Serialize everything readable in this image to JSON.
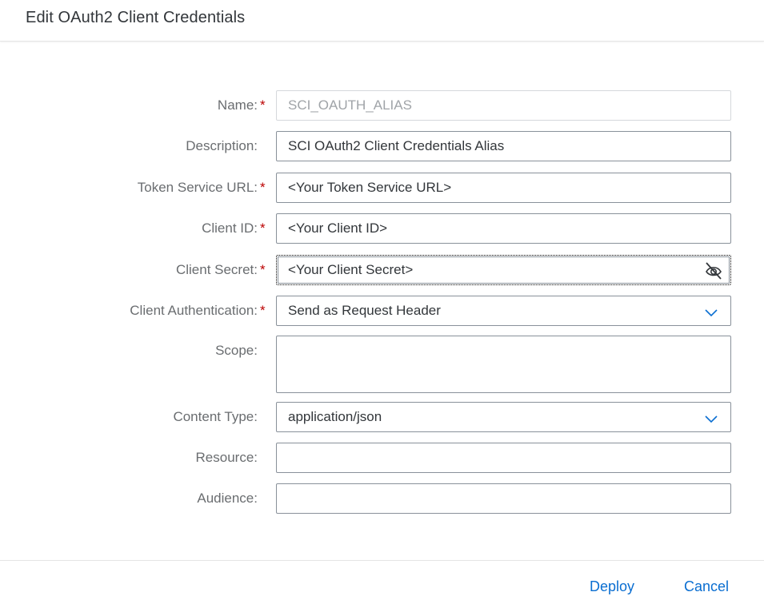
{
  "dialog": {
    "title": "Edit OAuth2 Client Credentials"
  },
  "form": {
    "name": {
      "label": "Name:",
      "required": "*",
      "value": "SCI_OAUTH_ALIAS"
    },
    "description": {
      "label": "Description:",
      "value": "SCI OAuth2 Client Credentials Alias"
    },
    "token_service_url": {
      "label": "Token Service URL:",
      "required": "*",
      "value": "<Your Token Service URL>"
    },
    "client_id": {
      "label": "Client ID:",
      "required": "*",
      "value": "<Your Client ID>"
    },
    "client_secret": {
      "label": "Client Secret:",
      "required": "*",
      "value": "<Your Client Secret>",
      "icon": "eye-slash-icon"
    },
    "client_authentication": {
      "label": "Client Authentication:",
      "required": "*",
      "value": "Send as Request Header",
      "icon": "chevron-down-icon"
    },
    "scope": {
      "label": "Scope:",
      "value": ""
    },
    "content_type": {
      "label": "Content Type:",
      "value": "application/json",
      "icon": "chevron-down-icon"
    },
    "resource": {
      "label": "Resource:",
      "value": ""
    },
    "audience": {
      "label": "Audience:",
      "value": ""
    }
  },
  "footer": {
    "deploy_label": "Deploy",
    "cancel_label": "Cancel"
  },
  "colors": {
    "accent": "#0a6ed1",
    "required": "#bb0000",
    "label": "#6a6d70",
    "border": "#89919a"
  }
}
